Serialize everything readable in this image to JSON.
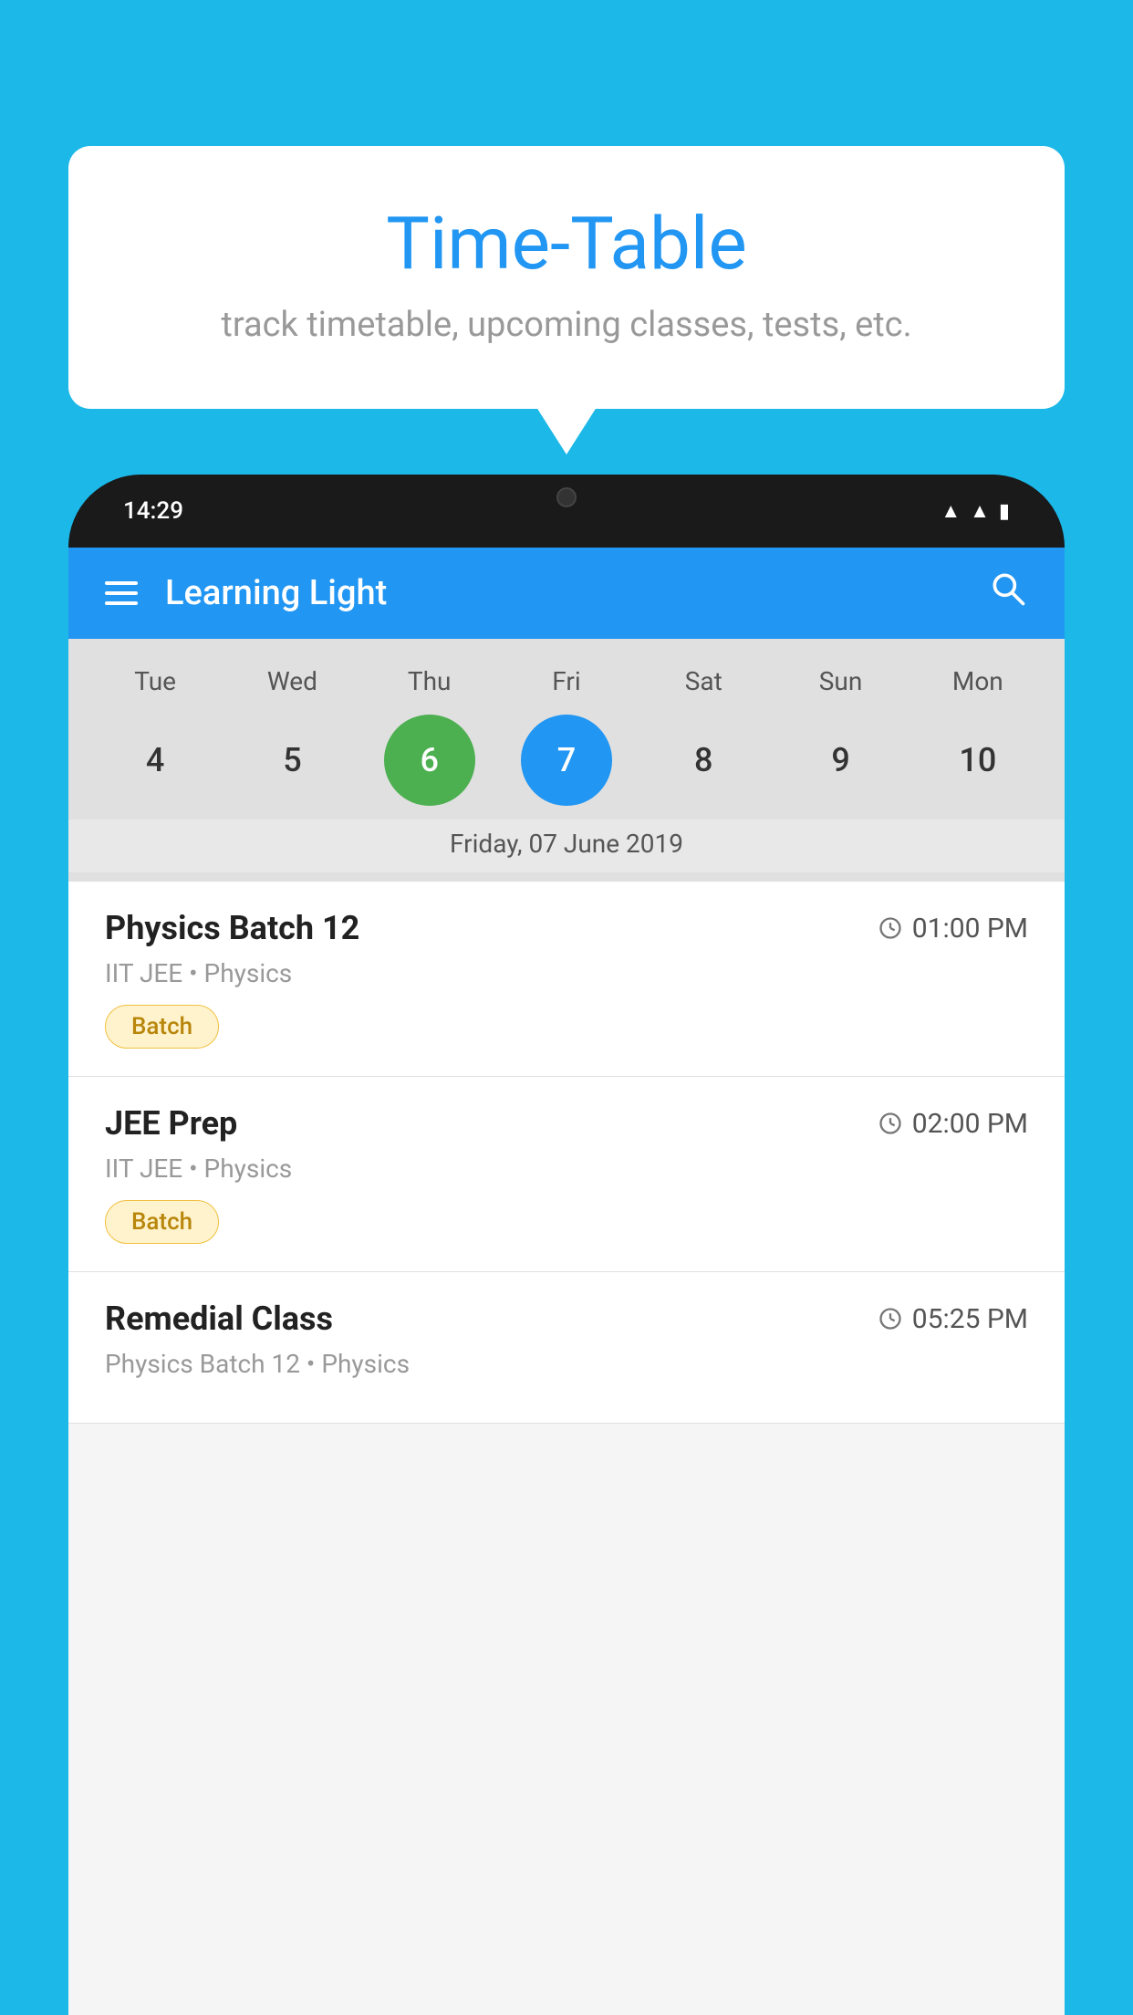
{
  "background_color": "#1BB8E8",
  "bubble": {
    "title": "Time-Table",
    "subtitle": "track timetable, upcoming classes, tests, etc."
  },
  "phone": {
    "status_bar": {
      "time": "14:29"
    },
    "toolbar": {
      "title": "Learning Light",
      "menu_icon_label": "menu",
      "search_icon_label": "search"
    },
    "calendar": {
      "days": [
        "Tue",
        "Wed",
        "Thu",
        "Fri",
        "Sat",
        "Sun",
        "Mon"
      ],
      "dates": [
        {
          "num": "4",
          "state": "normal"
        },
        {
          "num": "5",
          "state": "normal"
        },
        {
          "num": "6",
          "state": "today"
        },
        {
          "num": "7",
          "state": "selected"
        },
        {
          "num": "8",
          "state": "normal"
        },
        {
          "num": "9",
          "state": "normal"
        },
        {
          "num": "10",
          "state": "normal"
        }
      ],
      "selected_date_label": "Friday, 07 June 2019"
    },
    "schedule": [
      {
        "name": "Physics Batch 12",
        "time": "01:00 PM",
        "meta": "IIT JEE • Physics",
        "badge": "Batch"
      },
      {
        "name": "JEE Prep",
        "time": "02:00 PM",
        "meta": "IIT JEE • Physics",
        "badge": "Batch"
      },
      {
        "name": "Remedial Class",
        "time": "05:25 PM",
        "meta": "Physics Batch 12 • Physics",
        "badge": null
      }
    ]
  }
}
